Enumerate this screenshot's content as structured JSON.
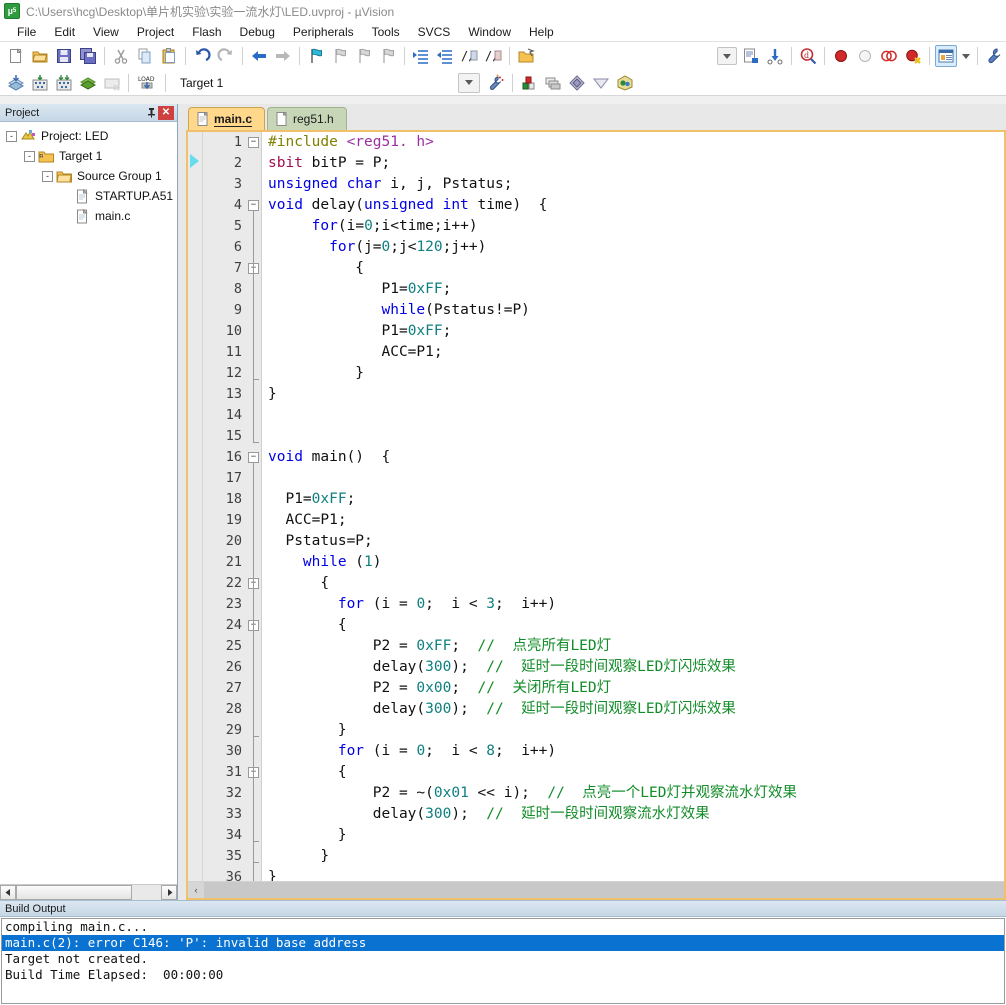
{
  "window": {
    "icon": "uvision-logo-icon",
    "title": "C:\\Users\\hcg\\Desktop\\单片机实验\\实验一流水灯\\LED.uvproj - µVision"
  },
  "menu": {
    "items": [
      {
        "label": "File"
      },
      {
        "label": "Edit"
      },
      {
        "label": "View"
      },
      {
        "label": "Project"
      },
      {
        "label": "Flash"
      },
      {
        "label": "Debug"
      },
      {
        "label": "Peripherals"
      },
      {
        "label": "Tools"
      },
      {
        "label": "SVCS"
      },
      {
        "label": "Window"
      },
      {
        "label": "Help"
      }
    ]
  },
  "toolbar_main": {
    "buttons": [
      {
        "name": "new-file-icon"
      },
      {
        "name": "open-file-icon"
      },
      {
        "name": "save-icon"
      },
      {
        "name": "save-all-icon"
      },
      {
        "name": "cut-icon"
      },
      {
        "name": "copy-icon"
      },
      {
        "name": "paste-icon"
      },
      {
        "name": "undo-icon"
      },
      {
        "name": "redo-icon"
      },
      {
        "name": "navigate-back-icon"
      },
      {
        "name": "navigate-forward-icon"
      },
      {
        "name": "bookmark-toggle-icon"
      },
      {
        "name": "bookmark-prev-icon"
      },
      {
        "name": "bookmark-next-icon"
      },
      {
        "name": "bookmark-clear-icon"
      },
      {
        "name": "indent-increase-icon"
      },
      {
        "name": "indent-decrease-icon"
      },
      {
        "name": "comment-lines-icon"
      },
      {
        "name": "uncomment-lines-icon"
      },
      {
        "name": "open-folder-icon"
      },
      {
        "name": "dropdown-arrow-icon"
      },
      {
        "name": "configure-icon"
      },
      {
        "name": "insert-binary-icon"
      },
      {
        "name": "find-in-files-icon"
      },
      {
        "name": "insert-breakpoint-icon"
      },
      {
        "name": "disable-breakpoint-icon"
      },
      {
        "name": "clear-breakpoints-icon"
      },
      {
        "name": "disable-all-breakpoints-icon"
      },
      {
        "name": "project-window-icon"
      },
      {
        "name": "project-window-dropdown-icon"
      },
      {
        "name": "configure-target-icon"
      }
    ]
  },
  "toolbar_build": {
    "buttons": [
      {
        "name": "translate-file-icon"
      },
      {
        "name": "build-target-icon"
      },
      {
        "name": "rebuild-all-icon"
      },
      {
        "name": "batch-build-icon"
      },
      {
        "name": "stop-build-icon"
      },
      {
        "name": "download-to-flash-icon"
      },
      {
        "name": "target-options-icon"
      },
      {
        "name": "manage-components-icon"
      },
      {
        "name": "manage-multi-project-icon"
      },
      {
        "name": "pack-installer-icon"
      },
      {
        "name": "pack-manager-icon"
      }
    ],
    "target_select": {
      "name": "target-selector",
      "value": "Target 1"
    }
  },
  "project_panel": {
    "title": "Project",
    "pin_icon": "pin-icon",
    "close_icon": "close-icon",
    "tree": [
      {
        "label": "Project: LED",
        "depth": 0,
        "expander": "-",
        "icon": "project-icon"
      },
      {
        "label": "Target 1",
        "depth": 1,
        "expander": "-",
        "icon": "target-folder-icon"
      },
      {
        "label": "Source Group 1",
        "depth": 2,
        "expander": "-",
        "icon": "folder-icon"
      },
      {
        "label": "STARTUP.A51",
        "depth": 3,
        "expander": "",
        "icon": "file-icon"
      },
      {
        "label": "main.c",
        "depth": 3,
        "expander": "",
        "icon": "file-icon"
      }
    ]
  },
  "editor": {
    "tabs": [
      {
        "label": "main.c",
        "active": true
      },
      {
        "label": "reg51.h",
        "active": false
      }
    ],
    "lines": [
      {
        "n": 1,
        "fold": "box-start",
        "tokens": [
          {
            "t": "#include ",
            "c": "pre"
          },
          {
            "t": "<reg51. h>",
            "c": "inc"
          }
        ]
      },
      {
        "n": 2,
        "fold": "none",
        "tokens": [
          {
            "t": "sbit",
            "c": "sb"
          },
          {
            "t": " bitP = P;",
            "c": "pl"
          }
        ]
      },
      {
        "n": 3,
        "fold": "none",
        "tokens": [
          {
            "t": "unsigned char",
            "c": "k"
          },
          {
            "t": " i, j, Pstatus;",
            "c": "pl"
          }
        ]
      },
      {
        "n": 4,
        "fold": "box",
        "tokens": [
          {
            "t": "void",
            "c": "k"
          },
          {
            "t": " delay(",
            "c": "pl"
          },
          {
            "t": "unsigned int",
            "c": "k"
          },
          {
            "t": " time)  {",
            "c": "pl"
          }
        ]
      },
      {
        "n": 5,
        "fold": "line",
        "tokens": [
          {
            "t": "     ",
            "c": "pl"
          },
          {
            "t": "for",
            "c": "k"
          },
          {
            "t": "(i=",
            "c": "pl"
          },
          {
            "t": "0",
            "c": "num"
          },
          {
            "t": ";i<time;i++)",
            "c": "pl"
          }
        ]
      },
      {
        "n": 6,
        "fold": "line",
        "tokens": [
          {
            "t": "       ",
            "c": "pl"
          },
          {
            "t": "for",
            "c": "k"
          },
          {
            "t": "(j=",
            "c": "pl"
          },
          {
            "t": "0",
            "c": "num"
          },
          {
            "t": ";j<",
            "c": "pl"
          },
          {
            "t": "120",
            "c": "num"
          },
          {
            "t": ";j++)",
            "c": "pl"
          }
        ]
      },
      {
        "n": 7,
        "fold": "box",
        "tokens": [
          {
            "t": "          {",
            "c": "pl"
          }
        ]
      },
      {
        "n": 8,
        "fold": "line",
        "tokens": [
          {
            "t": "             P1=",
            "c": "pl"
          },
          {
            "t": "0xFF",
            "c": "num"
          },
          {
            "t": ";",
            "c": "pl"
          }
        ]
      },
      {
        "n": 9,
        "fold": "line",
        "tokens": [
          {
            "t": "             ",
            "c": "pl"
          },
          {
            "t": "while",
            "c": "k"
          },
          {
            "t": "(Pstatus!=P)",
            "c": "pl"
          }
        ]
      },
      {
        "n": 10,
        "fold": "line",
        "tokens": [
          {
            "t": "             P1=",
            "c": "pl"
          },
          {
            "t": "0xFF",
            "c": "num"
          },
          {
            "t": ";",
            "c": "pl"
          }
        ]
      },
      {
        "n": 11,
        "fold": "line",
        "tokens": [
          {
            "t": "             ACC=P1;",
            "c": "pl"
          }
        ]
      },
      {
        "n": 12,
        "fold": "end",
        "tokens": [
          {
            "t": "          }",
            "c": "pl"
          }
        ]
      },
      {
        "n": 13,
        "fold": "line",
        "tokens": [
          {
            "t": "}",
            "c": "pl"
          }
        ]
      },
      {
        "n": 14,
        "fold": "line",
        "tokens": []
      },
      {
        "n": 15,
        "fold": "end",
        "tokens": []
      },
      {
        "n": 16,
        "fold": "box",
        "tokens": [
          {
            "t": "void",
            "c": "k"
          },
          {
            "t": " main()  {",
            "c": "pl"
          }
        ]
      },
      {
        "n": 17,
        "fold": "line",
        "tokens": []
      },
      {
        "n": 18,
        "fold": "line",
        "tokens": [
          {
            "t": "  P1=",
            "c": "pl"
          },
          {
            "t": "0xFF",
            "c": "num"
          },
          {
            "t": ";",
            "c": "pl"
          }
        ]
      },
      {
        "n": 19,
        "fold": "line",
        "tokens": [
          {
            "t": "  ACC=P1;",
            "c": "pl"
          }
        ]
      },
      {
        "n": 20,
        "fold": "line",
        "tokens": [
          {
            "t": "  Pstatus=P;",
            "c": "pl"
          }
        ]
      },
      {
        "n": 21,
        "fold": "line",
        "tokens": [
          {
            "t": "    ",
            "c": "pl"
          },
          {
            "t": "while",
            "c": "k"
          },
          {
            "t": " (",
            "c": "pl"
          },
          {
            "t": "1",
            "c": "num"
          },
          {
            "t": ")",
            "c": "pl"
          }
        ]
      },
      {
        "n": 22,
        "fold": "box",
        "tokens": [
          {
            "t": "      {",
            "c": "pl"
          }
        ]
      },
      {
        "n": 23,
        "fold": "line",
        "tokens": [
          {
            "t": "        ",
            "c": "pl"
          },
          {
            "t": "for",
            "c": "k"
          },
          {
            "t": " (i = ",
            "c": "pl"
          },
          {
            "t": "0",
            "c": "num"
          },
          {
            "t": ";  i < ",
            "c": "pl"
          },
          {
            "t": "3",
            "c": "num"
          },
          {
            "t": ";  i++)",
            "c": "pl"
          }
        ]
      },
      {
        "n": 24,
        "fold": "box",
        "tokens": [
          {
            "t": "        {",
            "c": "pl"
          }
        ]
      },
      {
        "n": 25,
        "fold": "line",
        "tokens": [
          {
            "t": "            P2 = ",
            "c": "pl"
          },
          {
            "t": "0xFF",
            "c": "num"
          },
          {
            "t": ";  ",
            "c": "pl"
          },
          {
            "t": "//  点亮所有LED灯",
            "c": "cm"
          }
        ]
      },
      {
        "n": 26,
        "fold": "line",
        "tokens": [
          {
            "t": "            delay(",
            "c": "pl"
          },
          {
            "t": "300",
            "c": "num"
          },
          {
            "t": ");  ",
            "c": "pl"
          },
          {
            "t": "//  延时一段时间观察LED灯闪烁效果",
            "c": "cm"
          }
        ]
      },
      {
        "n": 27,
        "fold": "line",
        "tokens": [
          {
            "t": "            P2 = ",
            "c": "pl"
          },
          {
            "t": "0x00",
            "c": "num"
          },
          {
            "t": ";  ",
            "c": "pl"
          },
          {
            "t": "//  关闭所有LED灯",
            "c": "cm"
          }
        ]
      },
      {
        "n": 28,
        "fold": "line",
        "tokens": [
          {
            "t": "            delay(",
            "c": "pl"
          },
          {
            "t": "300",
            "c": "num"
          },
          {
            "t": ");  ",
            "c": "pl"
          },
          {
            "t": "//  延时一段时间观察LED灯闪烁效果",
            "c": "cm"
          }
        ]
      },
      {
        "n": 29,
        "fold": "end",
        "tokens": [
          {
            "t": "        }",
            "c": "pl"
          }
        ]
      },
      {
        "n": 30,
        "fold": "line",
        "tokens": [
          {
            "t": "        ",
            "c": "pl"
          },
          {
            "t": "for",
            "c": "k"
          },
          {
            "t": " (i = ",
            "c": "pl"
          },
          {
            "t": "0",
            "c": "num"
          },
          {
            "t": ";  i < ",
            "c": "pl"
          },
          {
            "t": "8",
            "c": "num"
          },
          {
            "t": ";  i++)",
            "c": "pl"
          }
        ]
      },
      {
        "n": 31,
        "fold": "box",
        "tokens": [
          {
            "t": "        {",
            "c": "pl"
          }
        ]
      },
      {
        "n": 32,
        "fold": "line",
        "tokens": [
          {
            "t": "            P2 = ~(",
            "c": "pl"
          },
          {
            "t": "0x01",
            "c": "num"
          },
          {
            "t": " << i);  ",
            "c": "pl"
          },
          {
            "t": "//  点亮一个LED灯并观察流水灯效果",
            "c": "cm"
          }
        ]
      },
      {
        "n": 33,
        "fold": "line",
        "tokens": [
          {
            "t": "            delay(",
            "c": "pl"
          },
          {
            "t": "300",
            "c": "num"
          },
          {
            "t": ");  ",
            "c": "pl"
          },
          {
            "t": "//  延时一段时间观察流水灯效果",
            "c": "cm"
          }
        ]
      },
      {
        "n": 34,
        "fold": "end",
        "tokens": [
          {
            "t": "        }",
            "c": "pl"
          }
        ]
      },
      {
        "n": 35,
        "fold": "end",
        "tokens": [
          {
            "t": "      }",
            "c": "pl"
          }
        ]
      },
      {
        "n": 36,
        "fold": "line",
        "tokens": [
          {
            "t": "}",
            "c": "pl"
          }
        ]
      }
    ]
  },
  "build_output": {
    "title": "Build Output",
    "lines": [
      {
        "text": "compiling main.c...",
        "error": false
      },
      {
        "text": "main.c(2): error C146: 'P': invalid base address",
        "error": true
      },
      {
        "text": "Target not created.",
        "error": false
      },
      {
        "text": "Build Time Elapsed:  00:00:00",
        "error": false
      }
    ]
  },
  "colors": {
    "accent_tab_active": "#ffd88c",
    "accent_tab_inactive": "#c6d6b6",
    "error_highlight": "#0a72d0",
    "keyword": "#0000e6",
    "comment": "#128c28",
    "number": "#0f7f7f",
    "preprocessor": "#808000",
    "include_path": "#9b30a0",
    "sbit": "#a01050",
    "close_button": "#cf4040"
  }
}
